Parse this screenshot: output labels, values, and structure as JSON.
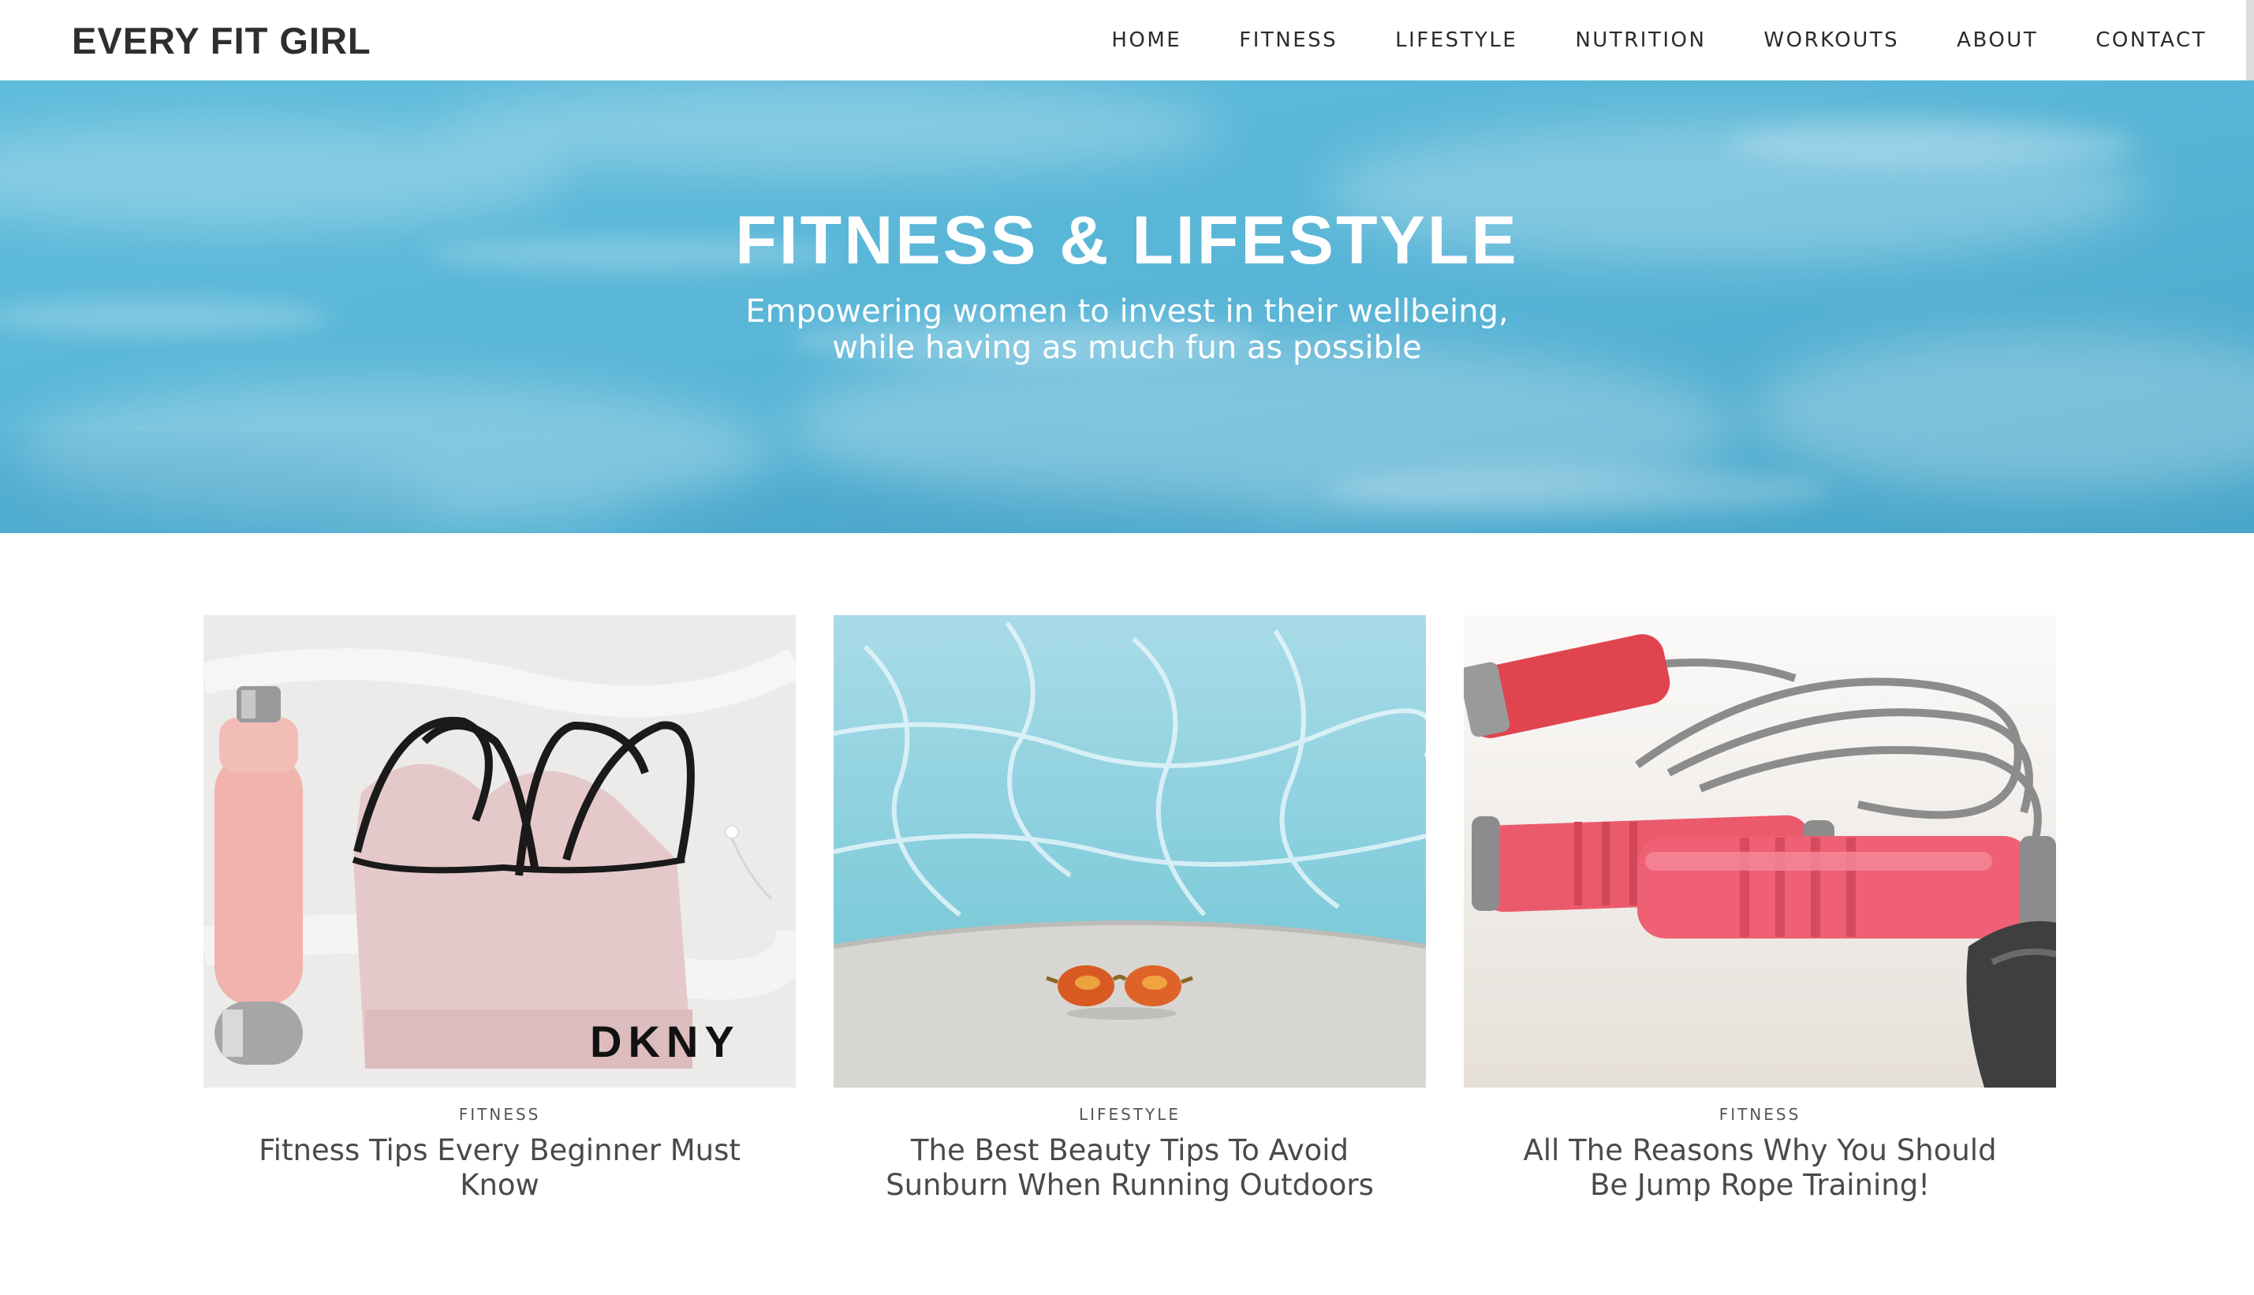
{
  "header": {
    "brand": "EVERY FIT GIRL",
    "nav": [
      {
        "label": "HOME"
      },
      {
        "label": "FITNESS"
      },
      {
        "label": "LIFESTYLE"
      },
      {
        "label": "NUTRITION"
      },
      {
        "label": "WORKOUTS"
      },
      {
        "label": "ABOUT"
      },
      {
        "label": "CONTACT"
      }
    ]
  },
  "hero": {
    "title": "FITNESS & LIFESTYLE",
    "subtitle_line1": "Empowering women to invest in their wellbeing,",
    "subtitle_line2": "while having as much fun as possible",
    "sky_color": "#57b3d4"
  },
  "posts": [
    {
      "category": "FITNESS",
      "title": "Fitness Tips Every Beginner Must Know",
      "image": "sports-bra-and-water-bottle",
      "image_text": "DKNY"
    },
    {
      "category": "LIFESTYLE",
      "title": "The Best Beauty Tips To Avoid Sunburn When Running Outdoors",
      "image": "sunglasses-by-pool"
    },
    {
      "category": "FITNESS",
      "title": "All The Reasons Why You Should Be Jump Rope Training!",
      "image": "pink-jump-rope"
    }
  ]
}
